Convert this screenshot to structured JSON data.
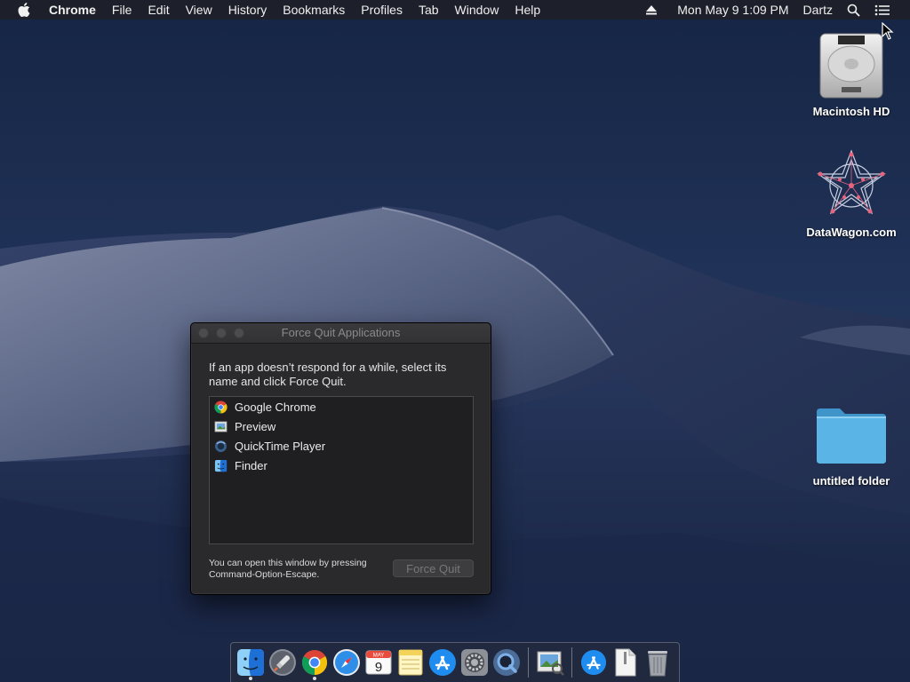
{
  "menubar": {
    "app_name": "Chrome",
    "menus": [
      "File",
      "Edit",
      "View",
      "History",
      "Bookmarks",
      "Profiles",
      "Tab",
      "Window",
      "Help"
    ],
    "clock": "Mon May 9  1:09 PM",
    "user": "Dartz"
  },
  "desktop": {
    "icons": [
      {
        "label": "Macintosh HD",
        "icon": "hard-drive-icon"
      },
      {
        "label": "DataWagon.com",
        "icon": "network-volume-icon"
      },
      {
        "label": "untitled folder",
        "icon": "folder-icon"
      }
    ]
  },
  "force_quit": {
    "title": "Force Quit Applications",
    "description": "If an app doesn’t respond for a while, select its name and click Force Quit.",
    "apps": [
      {
        "name": "Google Chrome",
        "icon": "chrome-icon"
      },
      {
        "name": "Preview",
        "icon": "preview-icon"
      },
      {
        "name": "QuickTime Player",
        "icon": "quicktime-icon"
      },
      {
        "name": "Finder",
        "icon": "finder-icon"
      }
    ],
    "hint": "You can open this window by pressing Command-Option-Escape.",
    "button_label": "Force Quit"
  },
  "dock": {
    "calendar_month": "MAY",
    "calendar_day": "9",
    "items": [
      "Finder",
      "Launchpad",
      "Google Chrome",
      "Safari",
      "Calendar",
      "Notes",
      "App Store",
      "System Preferences",
      "QuickTime Player",
      "Preview",
      "Downloads",
      "Documents",
      "Trash"
    ]
  },
  "colors": {
    "wallpaper_sky": "#1b2a4a",
    "window_bg": "#2a2a2c",
    "folder_blue": "#5ab4e6"
  }
}
